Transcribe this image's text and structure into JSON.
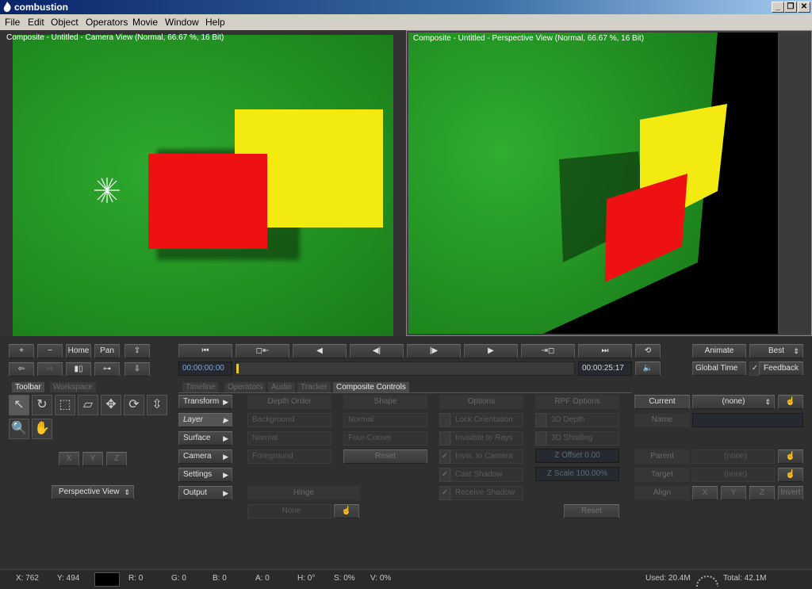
{
  "window": {
    "title": "combustion"
  },
  "menu": [
    "File",
    "Edit",
    "Object",
    "Operators",
    "Movie",
    "Window",
    "Help"
  ],
  "viewports": {
    "left_title": "Composite - Untitled - Camera View (Normal, 66.67 %, 16 Bit)",
    "right_title": "Composite - Untitled - Perspective View (Normal, 66.67 %, 16 Bit)"
  },
  "view_toolbar": {
    "home": "Home",
    "pan": "Pan",
    "plus": "+",
    "minus": "−"
  },
  "transport": {
    "start_time": "00:00:00:00",
    "end_time": "00:00:25:17"
  },
  "right_controls": {
    "animate": "Animate",
    "quality": "Best",
    "global_time": "Global Time",
    "feedback": "Feedback"
  },
  "left_tabs": {
    "toolbar": "Toolbar",
    "workspace": "Workspace"
  },
  "axes": {
    "x": "X",
    "y": "Y",
    "z": "Z"
  },
  "view_select": "Perspective View",
  "tabs": [
    "Timeline",
    "Operators",
    "Audio",
    "Tracker",
    "Composite Controls"
  ],
  "categories": [
    "Transform",
    "Layer",
    "Surface",
    "Camera",
    "Settings",
    "Output"
  ],
  "depth_order": {
    "header": "Depth Order",
    "items": [
      "Background",
      "Normal",
      "Foreground"
    ]
  },
  "shape": {
    "header": "Shape",
    "items": [
      "Normal",
      "Four-Corner"
    ],
    "reset": "Reset"
  },
  "options": {
    "header": "Options",
    "items": [
      "Lock Orientation",
      "Invisible to Rays",
      "Invis. to Camera",
      "Cast Shadow",
      "Receive Shadow"
    ]
  },
  "rpf": {
    "header": "RPF Options",
    "items": [
      "3D Depth",
      "3D Shading"
    ],
    "z_offset": "Z Offset 0.00",
    "z_scale": "Z Scale 100.00%",
    "reset": "Reset"
  },
  "hinge": {
    "header": "Hinge",
    "value": "None"
  },
  "object_panel": {
    "current_label": "Current",
    "current_value": "(none)",
    "name_label": "Name",
    "parent_label": "Parent",
    "parent_value": "(none)",
    "target_label": "Target",
    "target_value": "(none)",
    "align_label": "Align",
    "align_x": "X",
    "align_y": "Y",
    "align_z": "Z",
    "invert": "Invert"
  },
  "status": {
    "x": "X:   762",
    "y": "Y:  494",
    "r": "R: 0",
    "g": "G: 0",
    "b": "B: 0",
    "a": "A: 0",
    "h": "H: 0°",
    "s": "S: 0%",
    "v": "V: 0%",
    "used": "Used: 20.4M",
    "total": "Total: 42.1M"
  },
  "colors": {
    "green": "#2aa02a",
    "yellow": "#f2ea10",
    "red": "#ee1111",
    "panel": "#2f2f2f"
  }
}
